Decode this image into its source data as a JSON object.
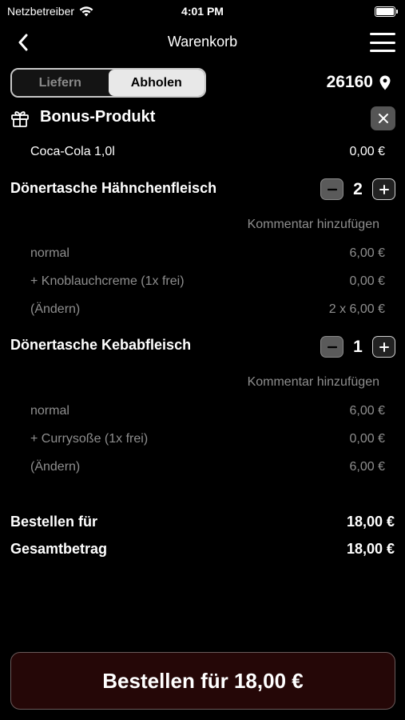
{
  "status": {
    "carrier": "Netzbetreiber",
    "time": "4:01 PM"
  },
  "nav": {
    "title": "Warenkorb"
  },
  "delivery_toggle": {
    "options": [
      "Liefern",
      "Abholen"
    ],
    "selected": "Abholen"
  },
  "location": {
    "zip": "26160"
  },
  "bonus": {
    "title": "Bonus-Produkt",
    "item": {
      "name": "Coca-Cola 1,0l",
      "price": "0,00 €"
    }
  },
  "products": [
    {
      "name": "Dönertasche Hähnchenfleisch",
      "quantity": "2",
      "comment_label": "Kommentar hinzufügen",
      "lines": [
        {
          "label": "normal",
          "price": "6,00 €"
        },
        {
          "label": "+ Knoblauchcreme (1x frei)",
          "price": "0,00 €"
        },
        {
          "label": "(Ändern)",
          "price": "2 x 6,00 €"
        }
      ]
    },
    {
      "name": "Dönertasche Kebabfleisch",
      "quantity": "1",
      "comment_label": "Kommentar hinzufügen",
      "lines": [
        {
          "label": "normal",
          "price": "6,00 €"
        },
        {
          "label": "+ Currysoße (1x frei)",
          "price": "0,00 €"
        },
        {
          "label": "(Ändern)",
          "price": "6,00 €"
        }
      ]
    }
  ],
  "totals": {
    "order_for_label": "Bestellen für",
    "order_for_value": "18,00 €",
    "grand_total_label": "Gesamtbetrag",
    "grand_total_value": "18,00 €"
  },
  "order_button": {
    "label": "Bestellen für 18,00 €"
  },
  "colors": {
    "background": "#000000",
    "button_bg": "#250707",
    "muted_text": "#8e8e8e"
  }
}
